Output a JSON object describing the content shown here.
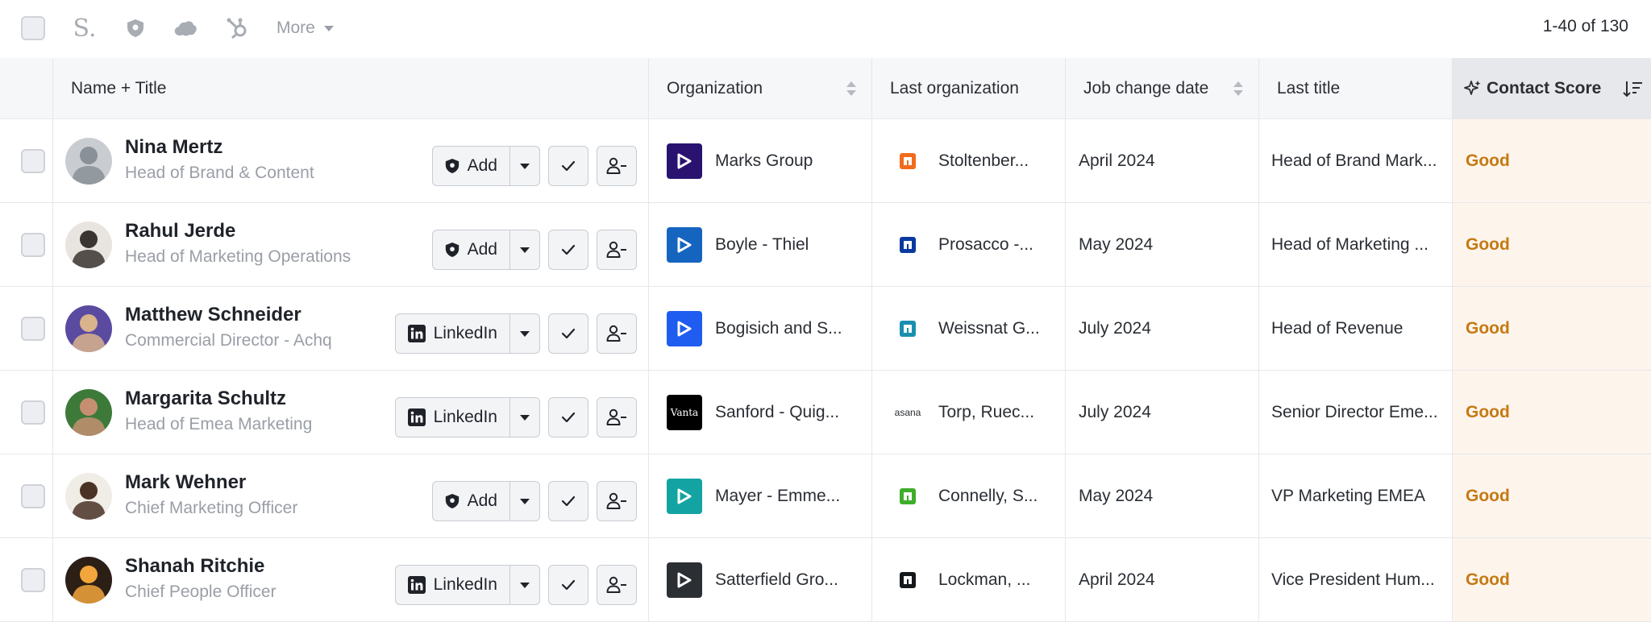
{
  "toolbar": {
    "more_label": "More",
    "pager": "1-40 of 130",
    "icons": [
      "s-logo-icon",
      "shield-icon",
      "salesforce-cloud-icon",
      "hubspot-icon"
    ]
  },
  "columns": {
    "name": "Name + Title",
    "organization": "Organization",
    "last_organization": "Last organization",
    "job_change_date": "Job change date",
    "last_title": "Last title",
    "contact_score": "Contact Score"
  },
  "colors": {
    "accent": "#c47a12",
    "score_bg": "#fdf4ec",
    "header_bg": "#f6f7f9"
  },
  "rows": [
    {
      "name": "Nina Mertz",
      "title": "Head of Brand & Content",
      "action": "Add",
      "action_icon": "shield-icon",
      "organization": "Marks Group",
      "org_logo_color": "#2a1370",
      "last_organization": "Stoltenber...",
      "last_org_logo_color": "#f26b1d",
      "job_change_date": "April 2024",
      "last_title": "Head of Brand Mark...",
      "score": "Good"
    },
    {
      "name": "Rahul Jerde",
      "title": "Head of Marketing Operations",
      "action": "Add",
      "action_icon": "shield-icon",
      "organization": "Boyle - Thiel",
      "org_logo_color": "#1565c0",
      "last_organization": "Prosacco -...",
      "last_org_logo_color": "#0a3aa0",
      "job_change_date": "May 2024",
      "last_title": "Head of Marketing ...",
      "score": "Good"
    },
    {
      "name": "Matthew Schneider",
      "title": "Commercial Director - Achq",
      "action": "LinkedIn",
      "action_icon": "linkedin-icon",
      "organization": "Bogisich and S...",
      "org_logo_color": "#1f5cf0",
      "last_organization": "Weissnat G...",
      "last_org_logo_color": "#1a8fb0",
      "job_change_date": "July 2024",
      "last_title": "Head of Revenue",
      "score": "Good"
    },
    {
      "name": "Margarita Schultz",
      "title": "Head of Emea Marketing",
      "action": "LinkedIn",
      "action_icon": "linkedin-icon",
      "organization": "Sanford - Quig...",
      "org_logo_color": "#000000",
      "org_logo_text": "Vanta",
      "last_organization": "Torp, Ruec...",
      "last_org_logo_color": "#f06a6a",
      "last_org_logo_text": "asana",
      "job_change_date": "July 2024",
      "last_title": "Senior Director Eme...",
      "score": "Good"
    },
    {
      "name": "Mark Wehner",
      "title": "Chief Marketing Officer",
      "action": "Add",
      "action_icon": "shield-icon",
      "organization": "Mayer - Emme...",
      "org_logo_color": "#14a3a3",
      "last_organization": "Connelly, S...",
      "last_org_logo_color": "#3fae2a",
      "job_change_date": "May 2024",
      "last_title": "VP Marketing EMEA",
      "score": "Good"
    },
    {
      "name": "Shanah Ritchie",
      "title": "Chief People Officer",
      "action": "LinkedIn",
      "action_icon": "linkedin-icon",
      "organization": "Satterfield Gro...",
      "org_logo_color": "#2b2f33",
      "last_organization": "Lockman, ...",
      "last_org_logo_color": "#15181b",
      "job_change_date": "April 2024",
      "last_title": "Vice President Hum...",
      "score": "Good"
    }
  ]
}
